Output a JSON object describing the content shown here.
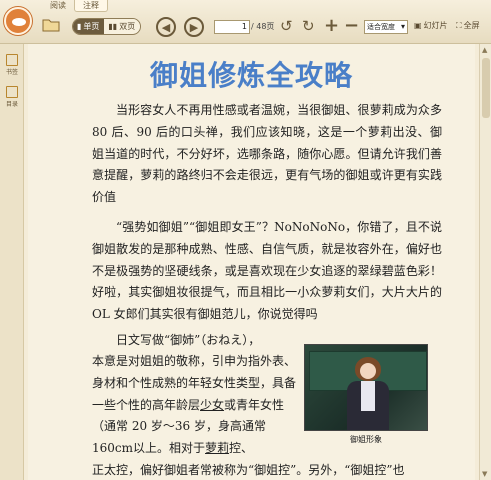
{
  "toolbar": {
    "tabs": [
      "阅读",
      "注释"
    ],
    "single_page": "单页",
    "double_page": "双页",
    "page_current": "1",
    "page_total": "/ 48页",
    "zoom_select": "适合宽度",
    "slideshow": "幻灯片",
    "fullscreen": "全屏"
  },
  "sidebar": {
    "items": [
      "书签",
      "目录"
    ]
  },
  "document": {
    "title": "御姐修炼全攻略",
    "para1": "当形容女人不再用性感或者温婉，当很御姐、很萝莉成为众多 80 后、90 后的口头禅，我们应该知晓，这是一个萝莉出没、御姐当道的时代，不分好坏，选哪条路，随你心愿。但请允许我们善意提醒，萝莉的路终归不会走很远，更有气场的御姐或许更有实践价值",
    "para2": "“强势如御姐”“御姐即女王”？NoNoNoNo，你错了，且不说御姐散发的是那种成熟、性感、自信气质，就是妆容外在，偏好也不是极强势的坚硬线条，或是喜欢现在少女追逐的翠绿碧蓝色彩！好啦，其实御姐妆很提气，而且相比一小众萝莉女们，大片大片的 OL 女郎们其实很有御姐范儿，你说觉得吗",
    "para3": "日文写做“御姉”（おねえ），",
    "para3_cont_a": "本意是对姐姐的敬称，引申为指外表、身材和个性成熟的年轻女性类型，具备一些个性的高年龄层",
    "para3_shoujo": "少女",
    "para3_cont_b": "或青年女性（通常 20 岁～36 岁，身高通常 160cm以上。相对于",
    "para3_loli": "萝莉",
    "para3_cont_c": "控、",
    "last_line": "正太控，偏好御姐者常被称为“御姐控”。另外，“御姐控”也",
    "image_caption": "御姐形象"
  }
}
